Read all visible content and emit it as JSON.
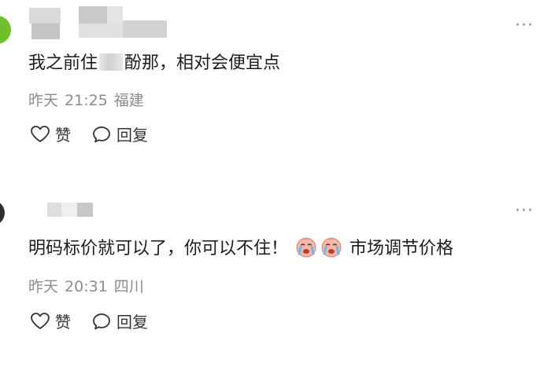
{
  "comments": [
    {
      "text_part1": "我之前住",
      "text_part2": "酚那，相对会便宜点",
      "date": "昨天",
      "time": "21:25",
      "location": "福建",
      "like_label": "赞",
      "reply_label": "回复",
      "more": "···"
    },
    {
      "text_part1": "明码标价就可以了，你可以不住！",
      "text_part2": "市场调节价格",
      "date": "昨天",
      "time": "20:31",
      "location": "四川",
      "like_label": "赞",
      "reply_label": "回复",
      "more": "···"
    }
  ],
  "colors": {
    "meta_gray": "#8c8c8c",
    "text": "#1c1c1c",
    "avatar_green": "#6fbf2a"
  }
}
